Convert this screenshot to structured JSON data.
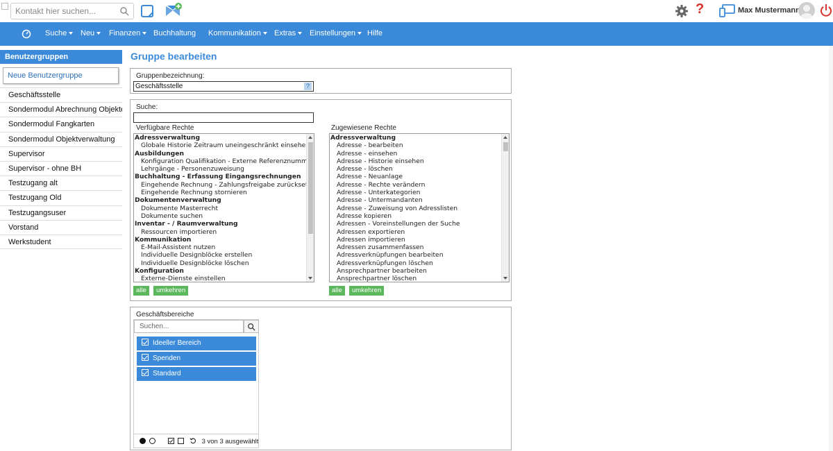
{
  "topbar": {
    "search_placeholder": "Kontakt hier suchen...",
    "help_symbol": "?",
    "user_name": "Max Mustermann",
    "icons": [
      "search-icon",
      "note-icon",
      "add-contact-icon",
      "gear-icon",
      "help-icon",
      "devices-icon",
      "avatar-icon",
      "power-icon"
    ]
  },
  "nav": {
    "items": [
      {
        "label": "Suche",
        "dropdown": true
      },
      {
        "label": "Neu",
        "dropdown": true
      },
      {
        "label": "Finanzen",
        "dropdown": true
      },
      {
        "label": "Buchhaltung",
        "dropdown": false
      },
      {
        "label": "Kommunikation",
        "dropdown": true
      },
      {
        "label": "Extras",
        "dropdown": true
      },
      {
        "label": "Einstellungen",
        "dropdown": true
      },
      {
        "label": "Hilfe",
        "dropdown": false
      }
    ]
  },
  "sidebar": {
    "header": "Benutzergruppen",
    "new_group": "Neue Benutzergruppe",
    "items": [
      "Geschäftsstelle",
      "Sondermodul Abrechnung Objekte",
      "Sondermodul Fangkarten",
      "Sondermodul Objektverwaltung",
      "Supervisor",
      "Supervisor - ohne BH",
      "Testzugang alt",
      "Testzugang Old",
      "Testzugangsuser",
      "Vorstand",
      "Werkstudent"
    ]
  },
  "main": {
    "title": "Gruppe bearbeiten",
    "group_name_label": "Gruppenbezeichnung:",
    "group_name_value": "Geschäftsstelle",
    "group_name_help": "?",
    "search_label": "Suche:",
    "search_value": "",
    "available_label": "Verfügbare Rechte",
    "assigned_label": "Zugewiesene Rechte",
    "available_rights": [
      {
        "text": "Adressverwaltung",
        "group": true
      },
      {
        "text": "Globale Historie Zeitraum uneingeschränkt einsehen",
        "group": false
      },
      {
        "text": "Ausbildungen",
        "group": true
      },
      {
        "text": "Konfiguration Qualifikation - Externe Referenznummer b",
        "group": false
      },
      {
        "text": "Lehrgänge - Personenzuweisung",
        "group": false
      },
      {
        "text": "Buchhaltung - Erfassung Eingangsrechnungen",
        "group": true
      },
      {
        "text": "Eingehende Rechnung - Zahlungsfreigabe zurücksetzen",
        "group": false
      },
      {
        "text": "Eingehende Rechnung stornieren",
        "group": false
      },
      {
        "text": "Dokumentenverwaltung",
        "group": true
      },
      {
        "text": "Dokumente Masterrecht",
        "group": false
      },
      {
        "text": "Dokumente suchen",
        "group": false
      },
      {
        "text": "Inventar - / Raumverwaltung",
        "group": true
      },
      {
        "text": "Ressourcen importieren",
        "group": false
      },
      {
        "text": "Kommunikation",
        "group": true
      },
      {
        "text": "E-Mail-Assistent nutzen",
        "group": false
      },
      {
        "text": "Individuelle Designblöcke erstellen",
        "group": false
      },
      {
        "text": "Individuelle Designblöcke löschen",
        "group": false
      },
      {
        "text": "Konfiguration",
        "group": true
      },
      {
        "text": "Externe-Dienste einstellen",
        "group": false
      }
    ],
    "assigned_rights": [
      {
        "text": "Adressverwaltung",
        "group": true
      },
      {
        "text": "Adresse - bearbeiten",
        "group": false
      },
      {
        "text": "Adresse - einsehen",
        "group": false
      },
      {
        "text": "Adresse - Historie einsehen",
        "group": false
      },
      {
        "text": "Adresse - löschen",
        "group": false
      },
      {
        "text": "Adresse - Neuanlage",
        "group": false
      },
      {
        "text": "Adresse - Rechte verändern",
        "group": false
      },
      {
        "text": "Adresse - Unterkategorien",
        "group": false
      },
      {
        "text": "Adresse - Untermandanten",
        "group": false
      },
      {
        "text": "Adresse - Zuweisung von Adresslisten",
        "group": false
      },
      {
        "text": "Adresse kopieren",
        "group": false
      },
      {
        "text": "Adressen - Voreinstellungen der Suche",
        "group": false
      },
      {
        "text": "Adressen exportieren",
        "group": false
      },
      {
        "text": "Adressen importieren",
        "group": false
      },
      {
        "text": "Adressen zusammenfassen",
        "group": false
      },
      {
        "text": "Adressverknüpfungen bearbeiten",
        "group": false
      },
      {
        "text": "Adressverknüpfungen löschen",
        "group": false
      },
      {
        "text": "Ansprechpartner bearbeiten",
        "group": false
      },
      {
        "text": "Ansprechpartner löschen",
        "group": false
      }
    ],
    "btn_all": "alle",
    "btn_invert": "umkehren",
    "business_areas_label": "Geschäftsbereiche",
    "business_search_placeholder": "Suchen...",
    "business_areas": [
      "Ideeller Bereich",
      "Spenden",
      "Standard"
    ],
    "business_footer_count": "3 von 3 ausgewählt"
  }
}
